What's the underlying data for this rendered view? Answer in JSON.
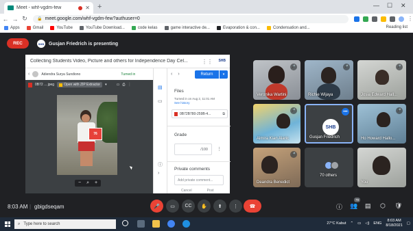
{
  "browser": {
    "tab_title": "Meet - whf-vgdm-few",
    "url": "meet.google.com/whf-vgdm-few?authuser=0",
    "bookmarks": [
      "Apps",
      "Gmail",
      "YouTube",
      "YouTube Download...",
      "code kelas",
      "game interactive de...",
      "Evaporation & con...",
      "Condensation and..."
    ],
    "reading_list": "Reading list"
  },
  "meet": {
    "rec_label": "REC",
    "presenter_logo": "SHB",
    "presenting_text": "Gusjan Friedrich is presenting",
    "time": "8:03 AM",
    "separator": "|",
    "meeting_code": "gbigdseqam",
    "people_count": "79"
  },
  "classroom": {
    "title": "Collecting Students Video, Picture and others for Independence Day Cel...",
    "logo": "SHB",
    "student_name": "Adiendra Surya Sundiono",
    "status": "Turned in",
    "file_short": "0B72 ... jpeg",
    "open_with": "Open with ZIP Extractor",
    "return_label": "Return",
    "files_label": "Files",
    "turned_in_on": "Turned in on Aug 2, 11:01 AM",
    "see_history": "See history",
    "file_chip": "0B72B780-259B-4...",
    "grade_label": "Grade",
    "grade_value": "/100",
    "comments_label": "Private comments",
    "comment_placeholder": "Add private comment...",
    "cancel": "Cancel",
    "post": "Post",
    "photo_card": "76"
  },
  "participants": [
    {
      "name": "Veronika Wartini"
    },
    {
      "name": "Richie Wijaya"
    },
    {
      "name": "Josia Edward Hall..."
    },
    {
      "name": "Almira Kian Alaric"
    },
    {
      "name": "Gusjan Friedrich"
    },
    {
      "name": "Ho Howard Hallo..."
    },
    {
      "name": "Deandra Benedict"
    },
    {
      "name": "70 others"
    },
    {
      "name": "You"
    }
  ],
  "taskbar": {
    "search_placeholder": "Type here to search",
    "weather": "27°C  Kabut",
    "lang": "ENG",
    "time": "8:03 AM",
    "date": "8/18/2021"
  }
}
